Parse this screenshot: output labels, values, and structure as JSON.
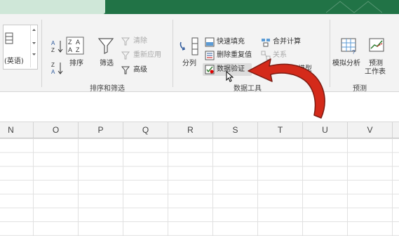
{
  "ribbon": {
    "font_combo_text": "(英语)",
    "sort_filter": {
      "sort_label": "排序",
      "filter_label": "筛选",
      "clear_label": "清除",
      "reapply_label": "重新应用",
      "advanced_label": "高级",
      "group_label": "排序和筛选"
    },
    "data_tools": {
      "text_to_columns_label": "分列",
      "flash_fill_label": "快速填充",
      "remove_duplicates_label": "删除重复值",
      "data_validation_label": "数据验证",
      "consolidate_label": "合并计算",
      "relationships_label": "关系",
      "data_model_label": "模型",
      "group_label": "数据工具"
    },
    "forecast": {
      "what_if_label": "模拟分析",
      "forecast_sheet_line1": "预测",
      "forecast_sheet_line2": "工作表",
      "group_label": "预测"
    }
  },
  "columns": [
    "N",
    "O",
    "P",
    "Q",
    "R",
    "S",
    "T",
    "U",
    "V"
  ],
  "colors": {
    "accent": "#217346",
    "arrow": "#d42a1a"
  }
}
